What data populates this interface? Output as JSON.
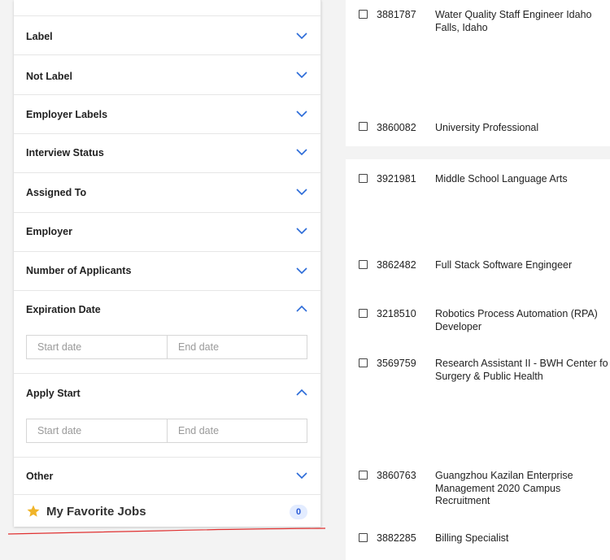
{
  "filters": {
    "items": [
      {
        "label": "Label",
        "expanded": false
      },
      {
        "label": "Not Label",
        "expanded": false
      },
      {
        "label": "Employer Labels",
        "expanded": false
      },
      {
        "label": "Interview Status",
        "expanded": false
      },
      {
        "label": "Assigned To",
        "expanded": false
      },
      {
        "label": "Employer",
        "expanded": false
      },
      {
        "label": "Number of Applicants",
        "expanded": false
      },
      {
        "label": "Expiration Date",
        "expanded": true
      },
      {
        "label": "Apply Start",
        "expanded": true
      },
      {
        "label": "Other",
        "expanded": false
      }
    ],
    "expiration_date": {
      "start_placeholder": "Start date",
      "end_placeholder": "End date"
    },
    "apply_start": {
      "start_placeholder": "Start date",
      "end_placeholder": "End date"
    }
  },
  "favorites": {
    "title": "My Favorite Jobs",
    "count": "0",
    "star_color": "#f0b429"
  },
  "jobs": [
    {
      "id": "3881787",
      "title_lines": [
        "Water Quality Staff Engineer Idaho",
        "Falls, Idaho"
      ]
    },
    {
      "id": "3860082",
      "title_lines": [
        "University Professional"
      ]
    },
    {
      "id": "3921981",
      "title_lines": [
        "Middle School Language Arts"
      ]
    },
    {
      "id": "3862482",
      "title_lines": [
        "Full Stack Software Engingeer"
      ]
    },
    {
      "id": "3218510",
      "title_lines": [
        "Robotics Process Automation (RPA)",
        "Developer"
      ]
    },
    {
      "id": "3569759",
      "title_lines": [
        "Research Assistant II - BWH Center fo",
        "Surgery & Public Health"
      ]
    },
    {
      "id": "3860763",
      "title_lines": [
        "Guangzhou Kazilan Enterprise",
        "Management 2020 Campus",
        "Recruitment"
      ]
    },
    {
      "id": "3882285",
      "title_lines": [
        "Billing Specialist"
      ]
    }
  ],
  "colors": {
    "accent": "#2a6ad8",
    "annotation_line": "#e03030"
  }
}
